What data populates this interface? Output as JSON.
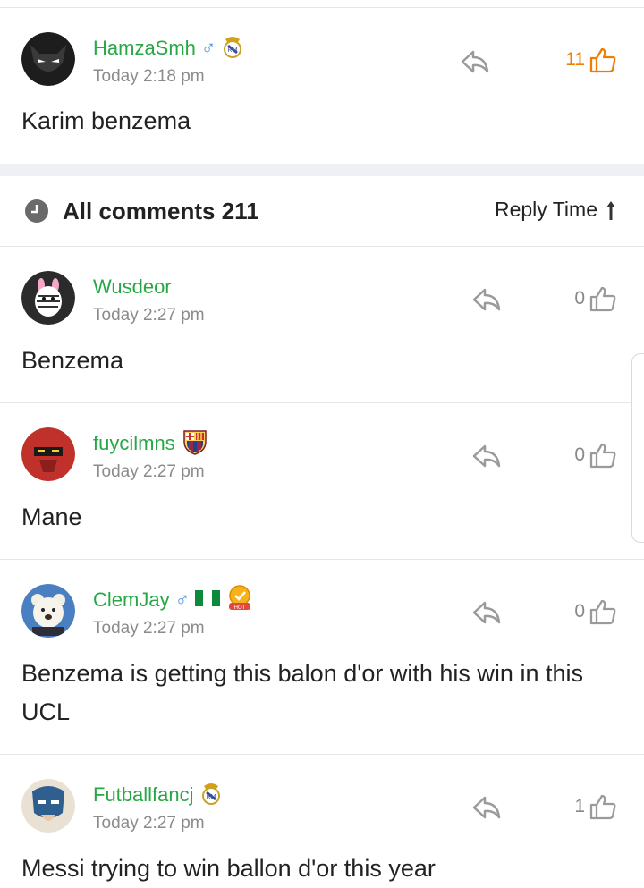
{
  "top_comment": {
    "username": "HamzaSmh",
    "gender": "♂",
    "time": "Today 2:18 pm",
    "text": "Karim benzema",
    "likes": "11",
    "badges": [
      "male-icon",
      "real-madrid-crest-icon"
    ]
  },
  "comments_header": {
    "title": "All comments 211",
    "sort_label": "Reply Time",
    "icon": "clock-icon",
    "sort_icon": "arrow-up-icon"
  },
  "comments": [
    {
      "username": "Wusdeor",
      "gender": "",
      "time": "Today 2:27 pm",
      "text": "Benzema",
      "likes": "0",
      "badges": []
    },
    {
      "username": "fuycilmns",
      "gender": "",
      "time": "Today 2:27 pm",
      "text": "Mane",
      "likes": "0",
      "badges": [
        "barcelona-crest-icon"
      ]
    },
    {
      "username": "ClemJay",
      "gender": "♂",
      "time": "Today 2:27 pm",
      "text": "Benzema is getting this balon d'or with his win in this UCL",
      "likes": "0",
      "badges": [
        "male-icon",
        "nigeria-flag-icon",
        "hot-medal-icon"
      ]
    },
    {
      "username": "Futballfancj",
      "gender": "",
      "time": "Today 2:27 pm",
      "text": "Messi trying to win ballon d'or this year",
      "likes": "1",
      "badges": [
        "real-madrid-crest-icon"
      ]
    }
  ],
  "colors": {
    "username": "#27a745",
    "like_top": "#f07c00",
    "separator_band": "#eef0f3"
  }
}
